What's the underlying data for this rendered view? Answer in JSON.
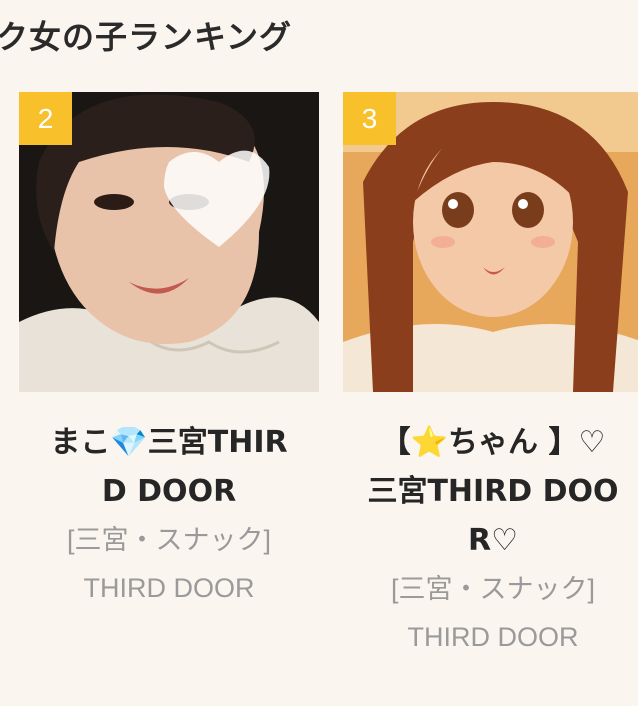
{
  "section": {
    "title": "ク女の子ランキング"
  },
  "cards": [
    {
      "rank": "2",
      "name_line1": "まこ💎三宮THIR",
      "name_line2": "D DOOR",
      "area": "[三宮・スナック]",
      "shop": "THIRD DOOR"
    },
    {
      "rank": "3",
      "name_line1": "【⭐ちゃん 】♡",
      "name_line2": "三宮THIRD DOO",
      "name_line3": "R♡",
      "area": "[三宮・スナック]",
      "shop": "THIRD DOOR"
    }
  ],
  "colors": {
    "background": "#faf5ef",
    "rank_badge": "#f8c12c",
    "name_text": "#262626",
    "sub_text": "#9a9a9a"
  },
  "icons": {
    "gem": "gem-emoji",
    "star": "star-emoji",
    "heart": "heart-outline"
  }
}
